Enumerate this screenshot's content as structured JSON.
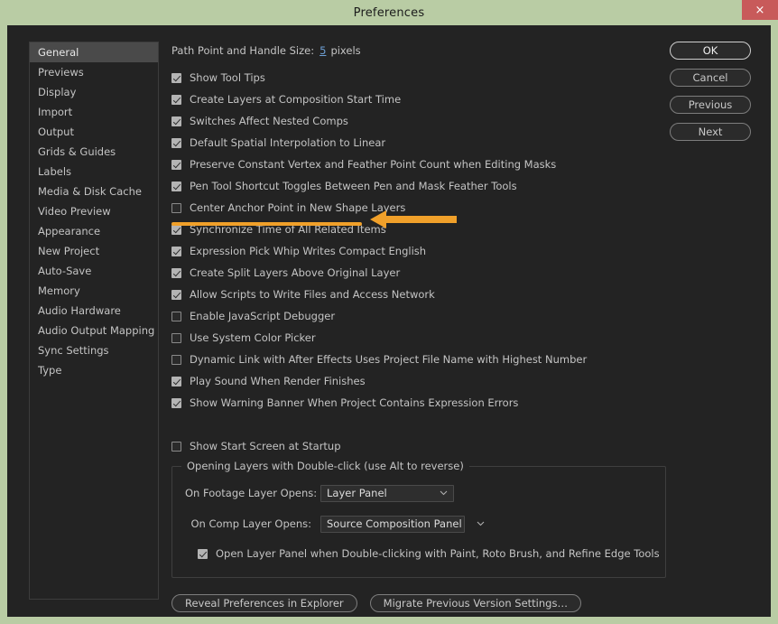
{
  "window": {
    "title": "Preferences",
    "close_label": "×",
    "frame_color": "#b9cca4",
    "titlebar_color": "#b9cca4",
    "close_color": "#c85a5a",
    "body_color": "#232323",
    "accent_color": "#f0a02a",
    "link_color": "#6e9fd4"
  },
  "sidebar": {
    "items": [
      {
        "label": "General",
        "selected": true
      },
      {
        "label": "Previews",
        "selected": false
      },
      {
        "label": "Display",
        "selected": false
      },
      {
        "label": "Import",
        "selected": false
      },
      {
        "label": "Output",
        "selected": false
      },
      {
        "label": "Grids & Guides",
        "selected": false
      },
      {
        "label": "Labels",
        "selected": false
      },
      {
        "label": "Media & Disk Cache",
        "selected": false
      },
      {
        "label": "Video Preview",
        "selected": false
      },
      {
        "label": "Appearance",
        "selected": false
      },
      {
        "label": "New Project",
        "selected": false
      },
      {
        "label": "Auto-Save",
        "selected": false
      },
      {
        "label": "Memory",
        "selected": false
      },
      {
        "label": "Audio Hardware",
        "selected": false
      },
      {
        "label": "Audio Output Mapping",
        "selected": false
      },
      {
        "label": "Sync Settings",
        "selected": false
      },
      {
        "label": "Type",
        "selected": false
      }
    ]
  },
  "main": {
    "path_point": {
      "label": "Path Point and Handle Size:",
      "value": "5",
      "unit": "pixels"
    },
    "checkboxes": [
      {
        "label": "Show Tool Tips",
        "checked": true
      },
      {
        "label": "Create Layers at Composition Start Time",
        "checked": true
      },
      {
        "label": "Switches Affect Nested Comps",
        "checked": true
      },
      {
        "label": "Default Spatial Interpolation to Linear",
        "checked": true,
        "highlighted": true
      },
      {
        "label": "Preserve Constant Vertex and Feather Point Count when Editing Masks",
        "checked": true
      },
      {
        "label": "Pen Tool Shortcut Toggles Between Pen and Mask Feather Tools",
        "checked": true
      },
      {
        "label": "Center Anchor Point in New Shape Layers",
        "checked": false
      },
      {
        "label": "Synchronize Time of All Related Items",
        "checked": true
      },
      {
        "label": "Expression Pick Whip Writes Compact English",
        "checked": true
      },
      {
        "label": "Create Split Layers Above Original Layer",
        "checked": true
      },
      {
        "label": "Allow Scripts to Write Files and Access Network",
        "checked": true
      },
      {
        "label": "Enable JavaScript Debugger",
        "checked": false
      },
      {
        "label": "Use System Color Picker",
        "checked": false
      },
      {
        "label": "Dynamic Link with After Effects Uses Project File Name with Highest Number",
        "checked": false
      },
      {
        "label": "Play Sound When Render Finishes",
        "checked": true
      },
      {
        "label": "Show Warning Banner When Project Contains Expression Errors",
        "checked": true
      }
    ],
    "start_screen": {
      "label": "Show Start Screen at Startup",
      "checked": false
    },
    "group": {
      "legend": "Opening Layers with Double-click (use Alt to reverse)",
      "footage_label": "On Footage Layer Opens:",
      "footage_value": "Layer Panel",
      "comp_label": "On Comp Layer Opens:",
      "comp_value": "Source Composition Panel",
      "open_layer_panel": {
        "label": "Open Layer Panel when Double-clicking with Paint, Roto Brush, and Refine Edge Tools",
        "checked": true
      }
    },
    "bottom_buttons": [
      {
        "label": "Reveal Preferences in Explorer"
      },
      {
        "label": "Migrate Previous Version Settings…"
      }
    ]
  },
  "right_buttons": [
    {
      "label": "OK",
      "primary": true
    },
    {
      "label": "Cancel",
      "primary": false
    },
    {
      "label": "Previous",
      "primary": false
    },
    {
      "label": "Next",
      "primary": false
    }
  ]
}
